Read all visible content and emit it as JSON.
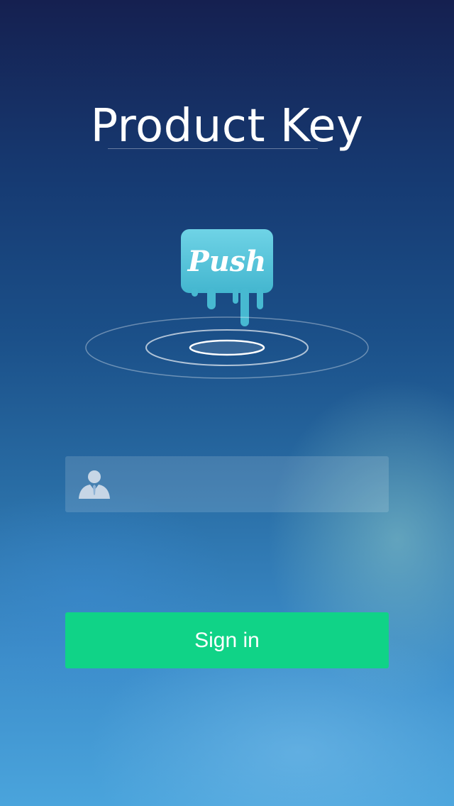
{
  "header": {
    "title": "Product Key"
  },
  "logo": {
    "text": "Push",
    "icon": "push-paint-drip-logo",
    "color": "#4fc0d6"
  },
  "login": {
    "username_icon": "user-icon",
    "username_value": "",
    "username_placeholder": ""
  },
  "actions": {
    "sign_in_label": "Sign in",
    "sign_in_color": "#10d387"
  }
}
